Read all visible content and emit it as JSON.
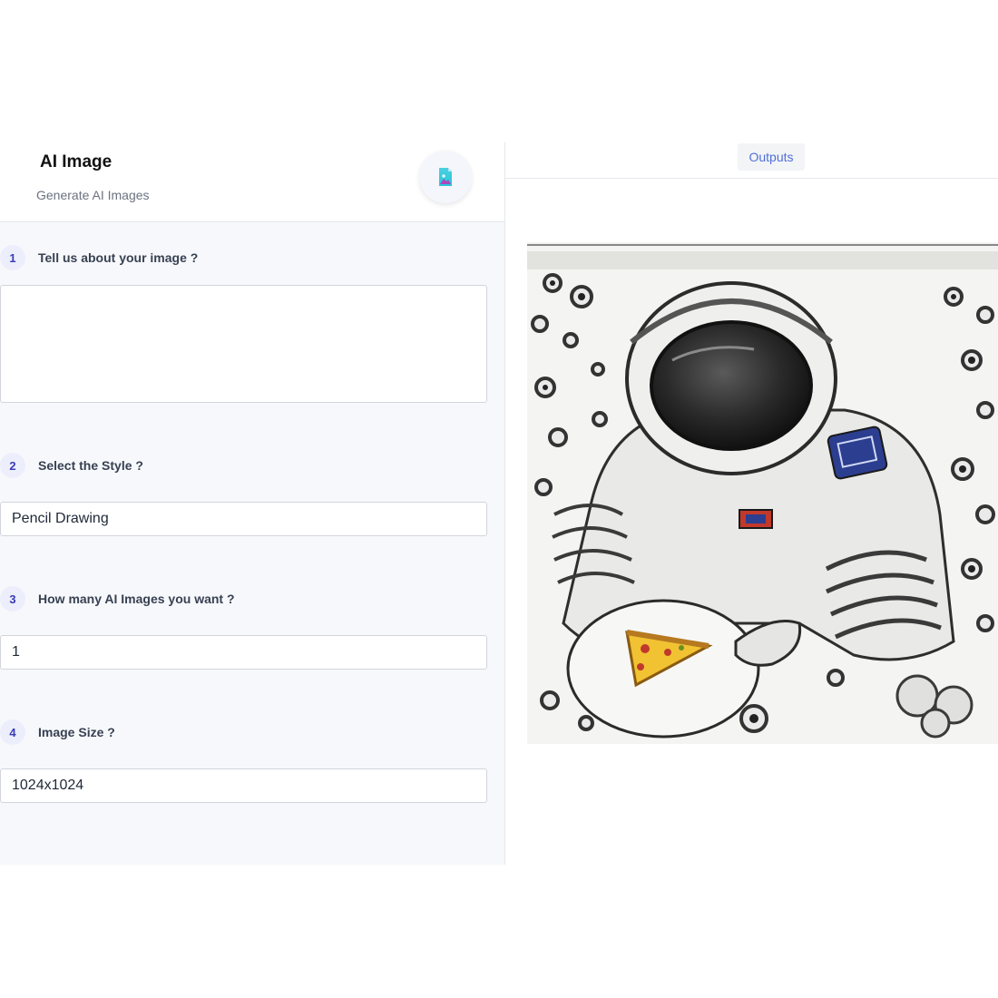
{
  "header": {
    "title": "AI Image",
    "subtitle": "Generate AI Images",
    "icon": "image-file-icon"
  },
  "form": {
    "questions": [
      {
        "number": "1",
        "label": "Tell us about your image ?",
        "value": ""
      },
      {
        "number": "2",
        "label": "Select the Style ?",
        "value": "Pencil Drawing"
      },
      {
        "number": "3",
        "label": "How many AI Images you want ?",
        "value": "1"
      },
      {
        "number": "4",
        "label": "Image Size ?",
        "value": "1024x1024"
      }
    ]
  },
  "output": {
    "tab_label": "Outputs",
    "image_subject": "pencil-drawing-astronaut-with-pizza"
  },
  "colors": {
    "accent": "#3b3bb8",
    "tab_text": "#4f6fd8",
    "panel_bg": "#f7f8fc"
  }
}
